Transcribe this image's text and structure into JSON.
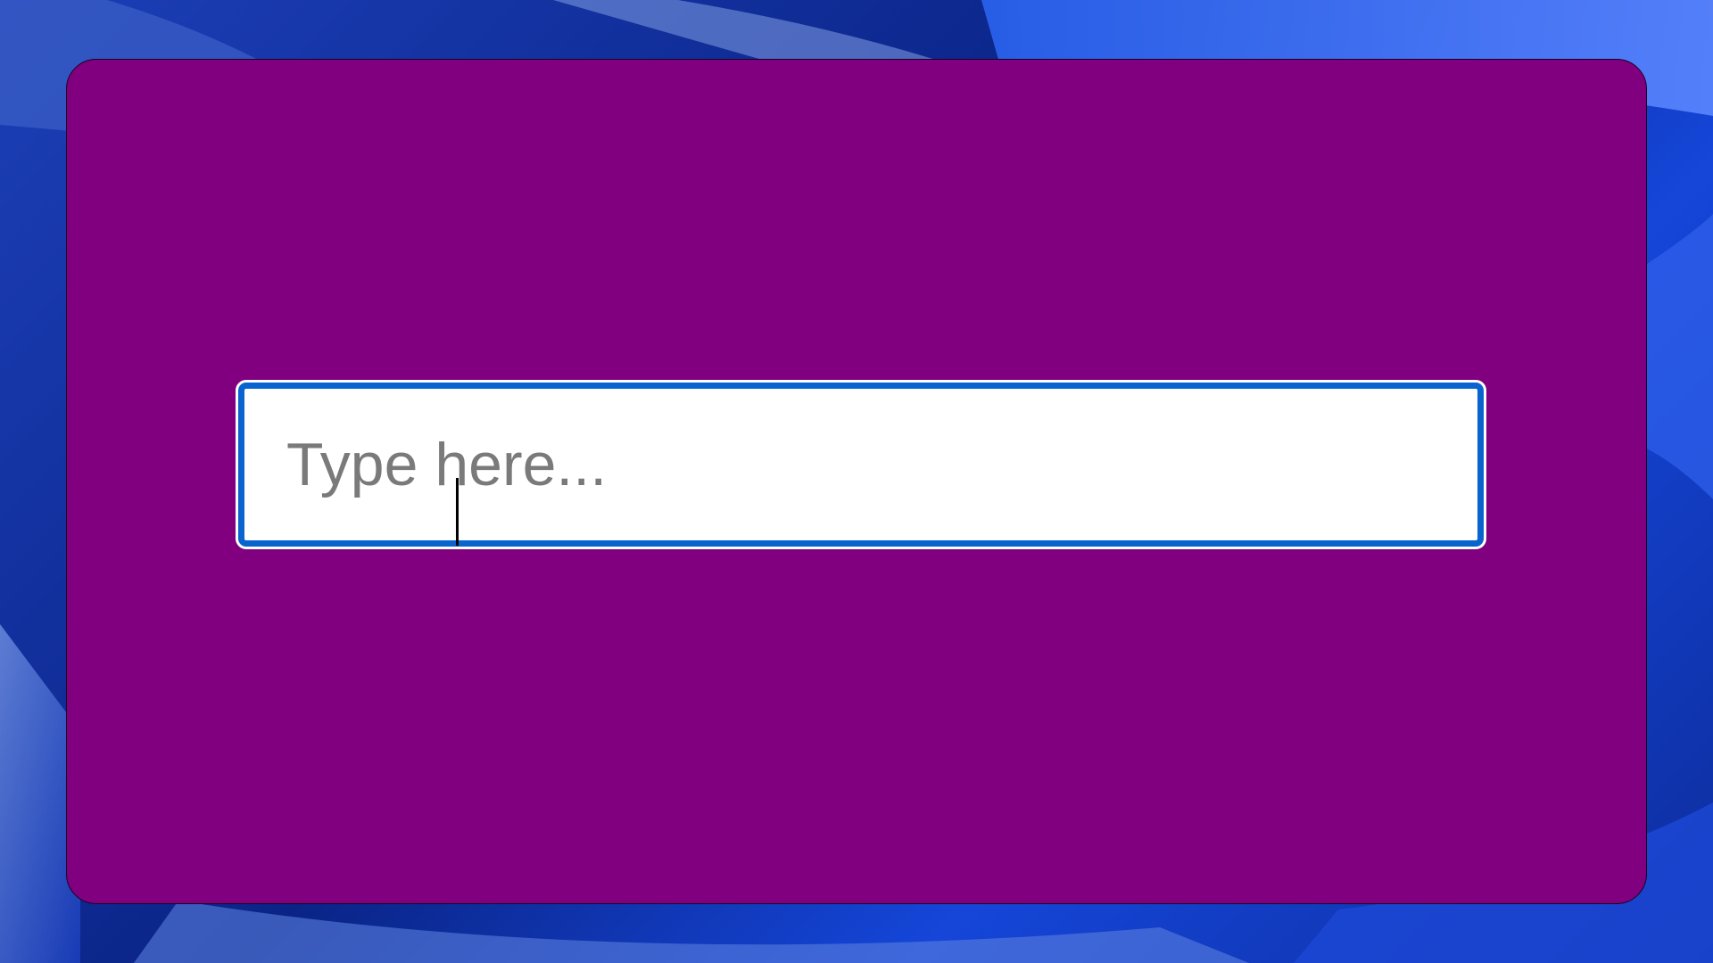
{
  "colors": {
    "window_background": "#800080",
    "input_border": "#0a64d0",
    "input_background": "#ffffff",
    "placeholder_text": "#7a7a7a",
    "desktop_background": "#0c2a8f"
  },
  "text_input": {
    "placeholder": "Type here...",
    "value": ""
  }
}
